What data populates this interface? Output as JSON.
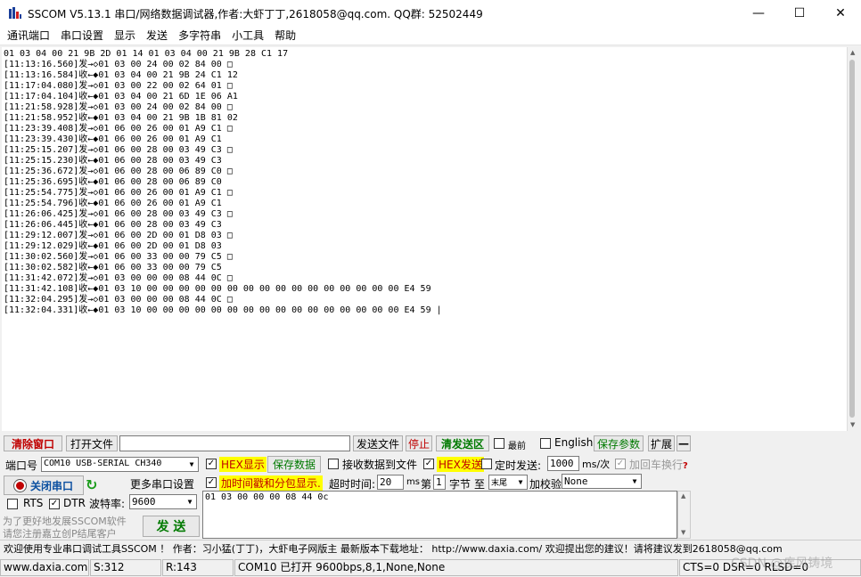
{
  "window": {
    "title": "SSCOM V5.13.1 串口/网络数据调试器,作者:大虾丁丁,2618058@qq.com. QQ群: 52502449",
    "minimize": "—",
    "maximize": "☐",
    "close": "✕"
  },
  "menu": [
    "通讯端口",
    "串口设置",
    "显示",
    "发送",
    "多字符串",
    "小工具",
    "帮助"
  ],
  "log_lines": [
    "01 03 04 00 21 9B 2D 01 14 01 03 04 00 21 9B 28 C1 17",
    "[11:13:16.560]发→◇01 03 00 24 00 02 84 00 □",
    "[11:13:16.584]收←◆01 03 04 00 21 9B 24 C1 12",
    "[11:17:04.080]发→◇01 03 00 22 00 02 64 01 □",
    "[11:17:04.104]收←◆01 03 04 00 21 6D 1E 06 A1",
    "[11:21:58.928]发→◇01 03 00 24 00 02 84 00 □",
    "[11:21:58.952]收←◆01 03 04 00 21 9B 1B 81 02",
    "[11:23:39.408]发→◇01 06 00 26 00 01 A9 C1 □",
    "[11:23:39.430]收←◆01 06 00 26 00 01 A9 C1",
    "[11:25:15.207]发→◇01 06 00 28 00 03 49 C3 □",
    "[11:25:15.230]收←◆01 06 00 28 00 03 49 C3",
    "[11:25:36.672]发→◇01 06 00 28 00 06 89 C0 □",
    "[11:25:36.695]收←◆01 06 00 28 00 06 89 C0",
    "[11:25:54.775]发→◇01 06 00 26 00 01 A9 C1 □",
    "[11:25:54.796]收←◆01 06 00 26 00 01 A9 C1",
    "[11:26:06.425]发→◇01 06 00 28 00 03 49 C3 □",
    "[11:26:06.445]收←◆01 06 00 28 00 03 49 C3",
    "[11:29:12.007]发→◇01 06 00 2D 00 01 D8 03 □",
    "[11:29:12.029]收←◆01 06 00 2D 00 01 D8 03",
    "[11:30:02.560]发→◇01 06 00 33 00 00 79 C5 □",
    "[11:30:02.582]收←◆01 06 00 33 00 00 79 C5",
    "[11:31:42.072]发→◇01 03 00 00 00 08 44 0C □",
    "[11:31:42.108]收←◆01 03 10 00 00 00 00 00 00 00 00 00 00 00 00 00 00 00 00 E4 59",
    "[11:32:04.295]发→◇01 03 00 00 00 08 44 0C □",
    "[11:32:04.331]收←◆01 03 10 00 00 00 00 00 00 00 00 00 00 00 00 00 00 00 00 E4 59 |"
  ],
  "toolbar": {
    "clear_window": "清除窗口",
    "open_file": "打开文件",
    "file_path": "",
    "send_file": "发送文件",
    "stop": "停止",
    "clear_send": "清发送区",
    "last": "最前",
    "english": "English",
    "save_params": "保存参数",
    "expand": "扩展",
    "collapse": "—"
  },
  "controls": {
    "port_label": "端口号",
    "port_value": "COM10 USB-SERIAL CH340",
    "hex_display": "HEX显示",
    "save_data": "保存数据",
    "recv_to_file": "接收数据到文件",
    "hex_send": "HEX发送",
    "timed_send": "定时发送:",
    "interval": "1000",
    "interval_unit": "ms/次",
    "add_crlf": "加回车换行",
    "close_port": "关闭串口",
    "more_settings": "更多串口设置",
    "timestamp": "加时间戳和分包显示.",
    "timeout_label": "超时时间:",
    "timeout_value": "20",
    "timeout_unit": "ms",
    "byte_prefix": "第",
    "byte_value": "1",
    "byte_label": "字节",
    "to_label": "至",
    "end_value": "末尾",
    "checksum_label": "加校验",
    "checksum_value": "None",
    "rts": "RTS",
    "dtr": "DTR",
    "baud_label": "波特率:",
    "baud_value": "9600",
    "send_text": "01 03 00 00 00 08 44 0c",
    "promo1": "为了更好地发展SSCOM软件",
    "promo2": "请您注册嘉立创P结尾客户",
    "send_button": "发 送"
  },
  "ticker": "欢迎使用专业串口调试工具SSCOM ！  作者：习小猛(丁丁)，大虾电子网版主  最新版本下载地址： http://www.daxia.com/  欢迎提出您的建议！请将建议发到2618058@qq.com",
  "status": {
    "site": "www.daxia.com",
    "sent": "S:312",
    "recv": "R:143",
    "port": "COM10 已打开  9600bps,8,1,None,None",
    "lines": "CTS=0 DSR=0 RLSD=0"
  },
  "watermark": "CSDN @疾风铸境"
}
